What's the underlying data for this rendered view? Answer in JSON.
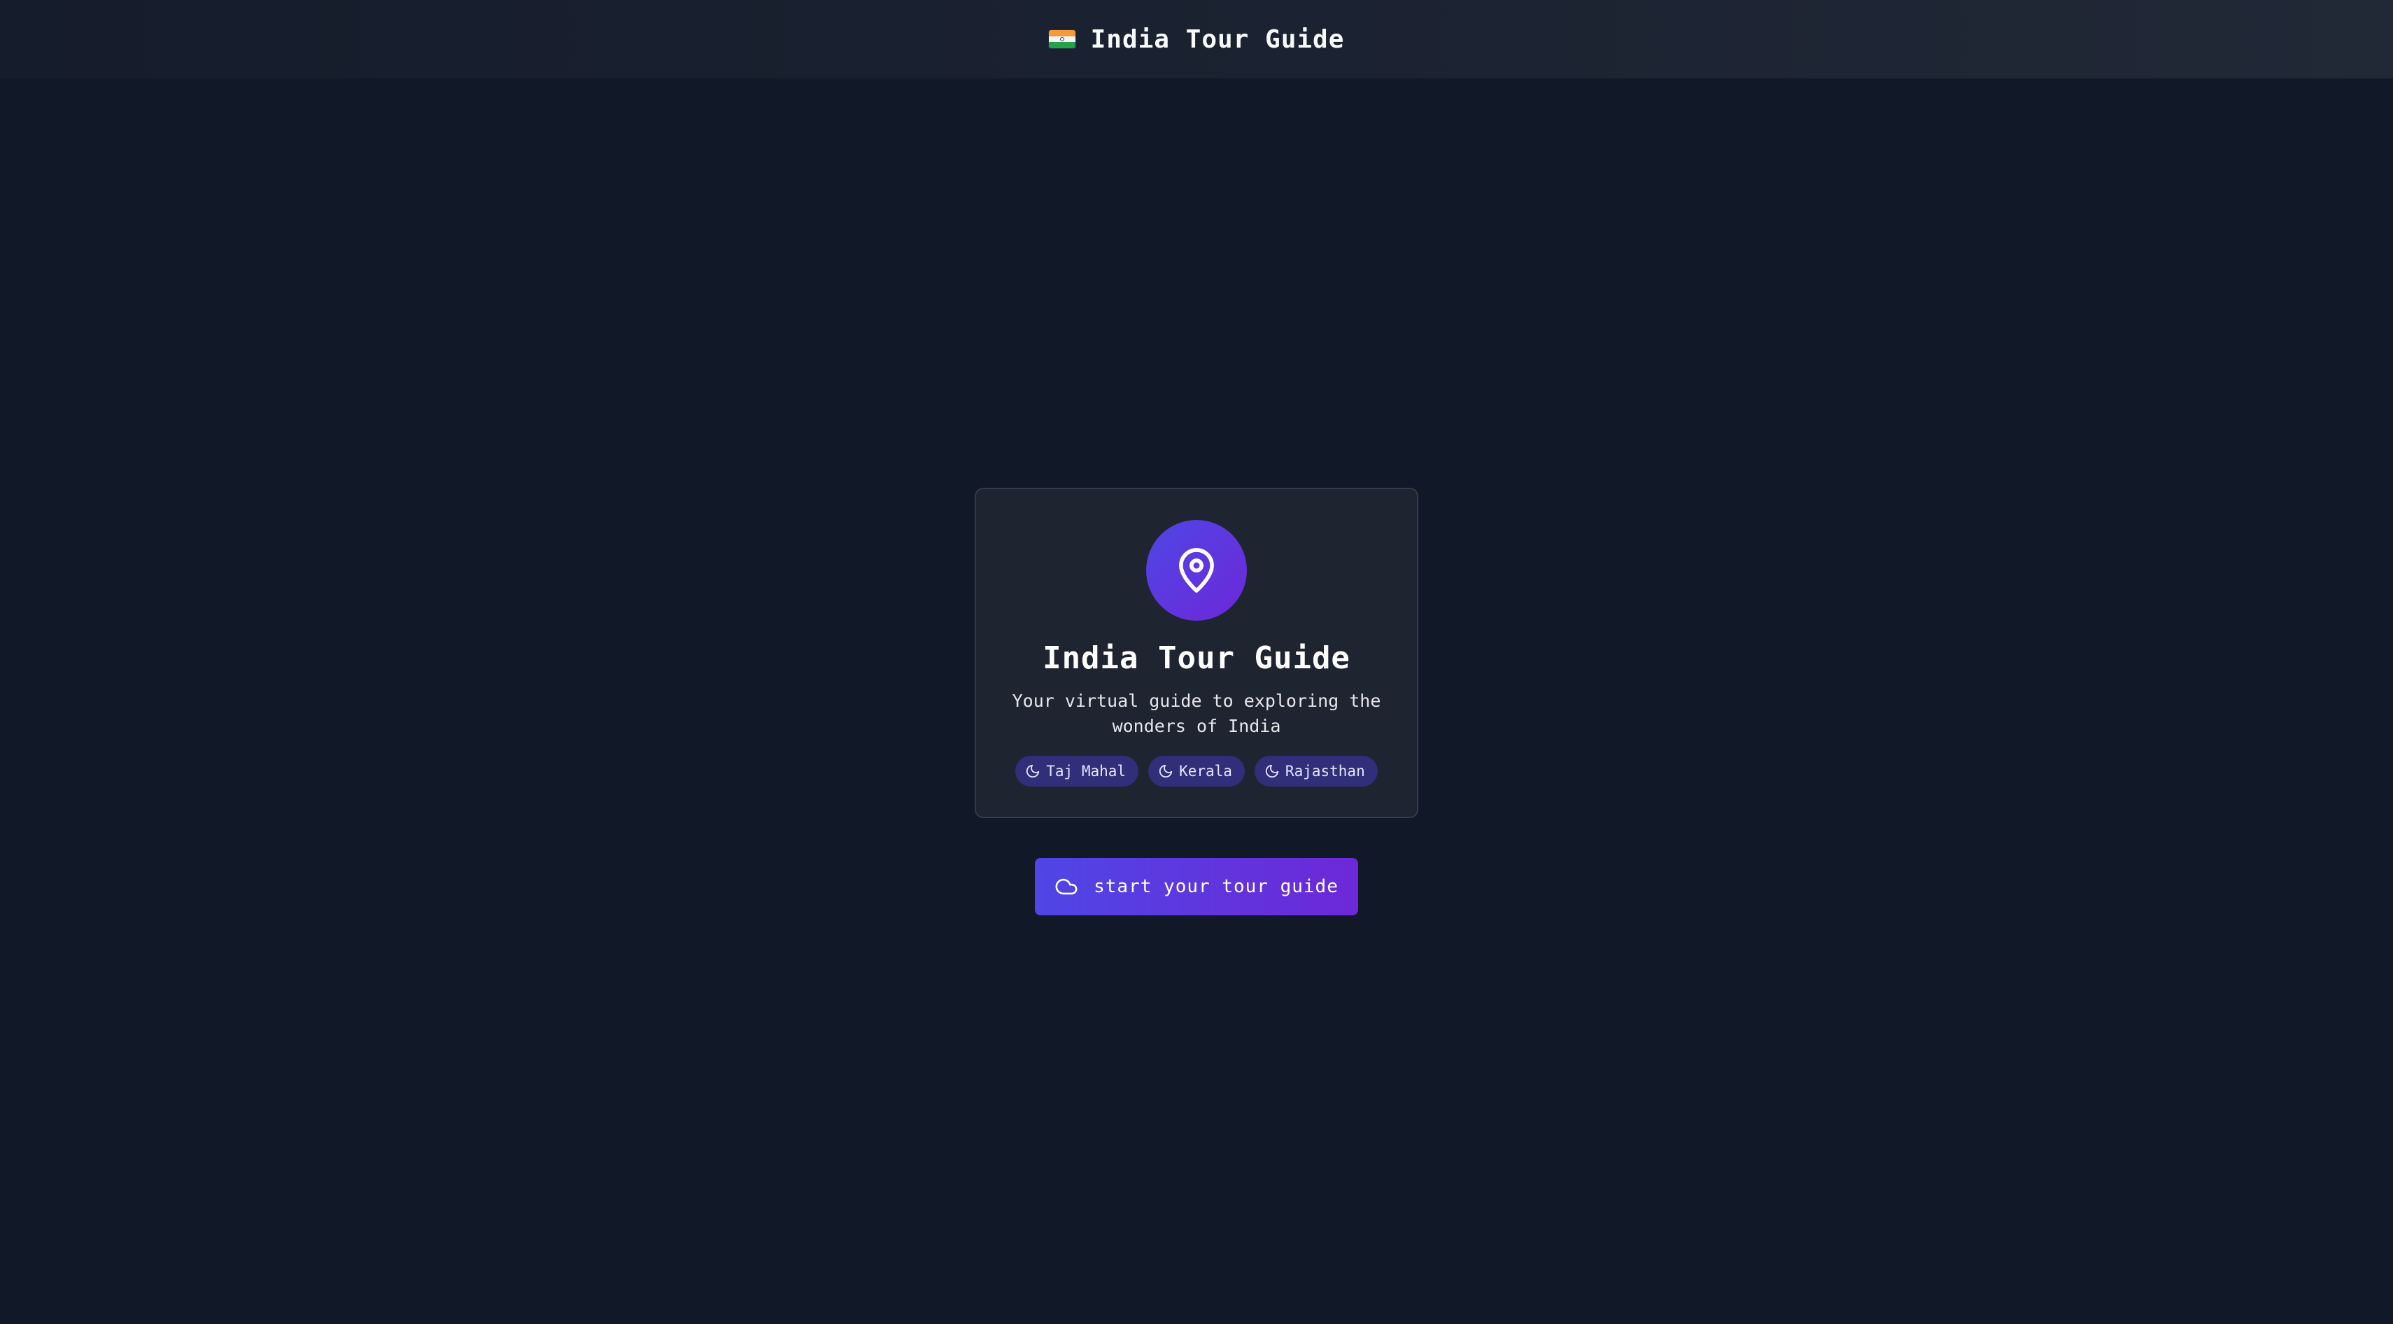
{
  "header": {
    "flag_icon": "india-flag-icon",
    "title": "India Tour Guide"
  },
  "card": {
    "icon": "map-pin-icon",
    "title": "India Tour Guide",
    "subtitle": "Your virtual guide to exploring the wonders of India",
    "tags": [
      {
        "label": "Taj Mahal",
        "icon": "moon-icon"
      },
      {
        "label": "Kerala",
        "icon": "moon-icon"
      },
      {
        "label": "Rajasthan",
        "icon": "moon-icon"
      }
    ]
  },
  "cta": {
    "icon": "cloud-icon",
    "label": "start your tour guide"
  },
  "colors": {
    "background": "#111827",
    "card": "#1f2431",
    "accent_start": "#4f46e5",
    "accent_end": "#6d28d9",
    "tag_bg": "#312e7a"
  }
}
